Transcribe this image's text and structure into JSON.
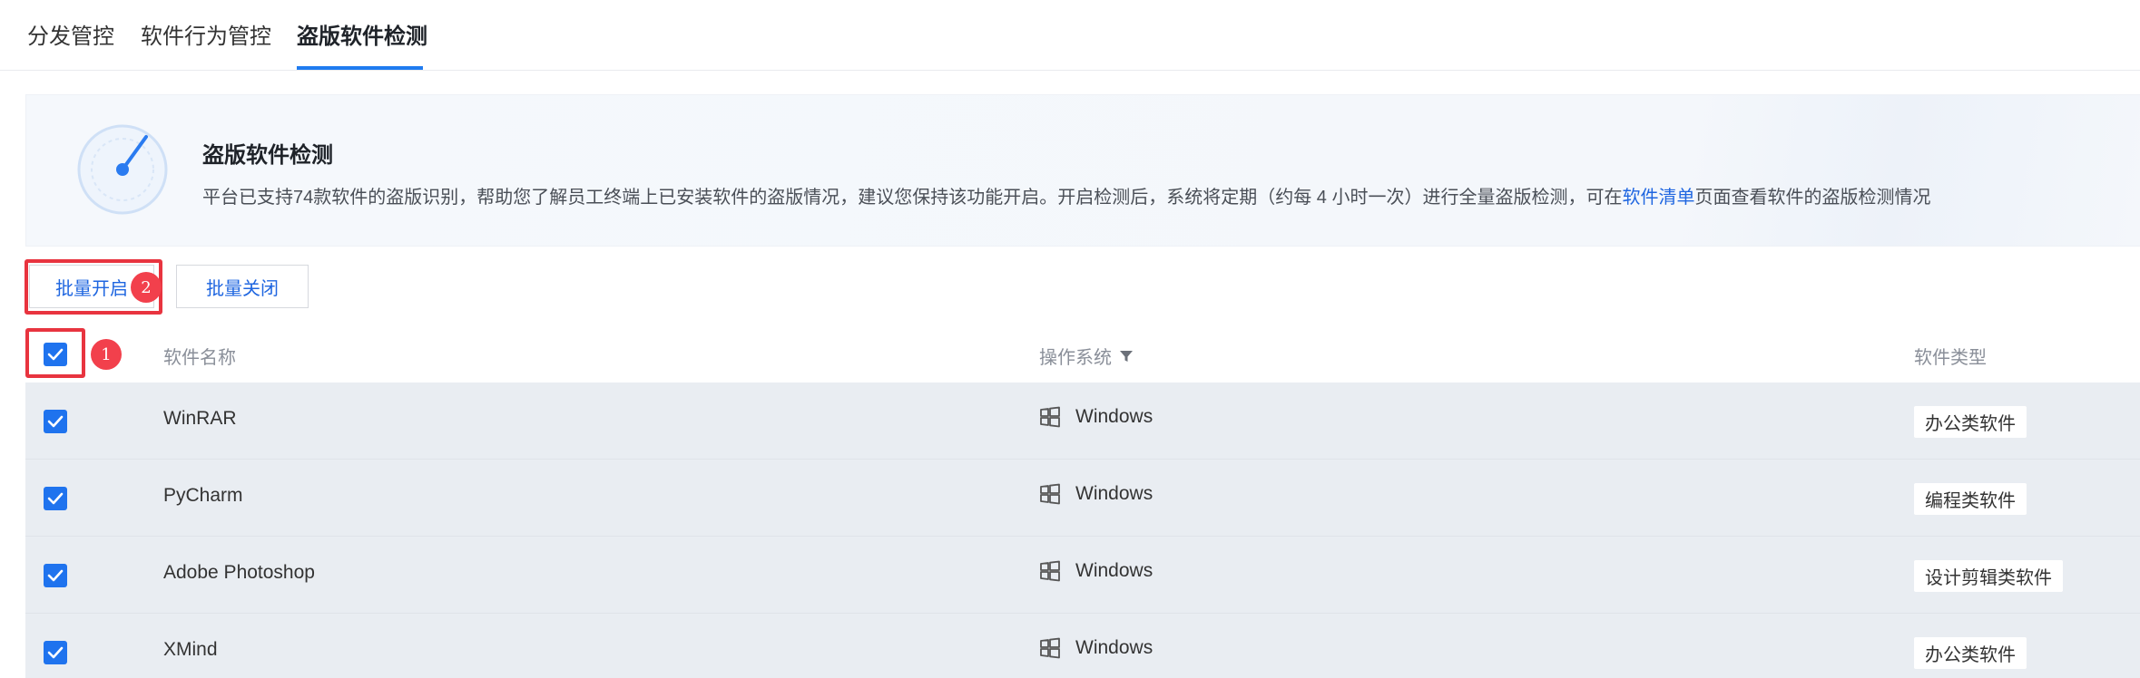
{
  "tabs": [
    {
      "label": "分发管控",
      "active": false
    },
    {
      "label": "软件行为管控",
      "active": false
    },
    {
      "label": "盗版软件检测",
      "active": true
    }
  ],
  "banner": {
    "icon": "gauge-icon",
    "title": "盗版软件检测",
    "desc_before": "平台已支持74款软件的盗版识别，帮助您了解员工终端上已安装软件的盗版情况，建议您保持该功能开启。开启检测后，系统将定期（约每 4 小时一次）进行全量盗版检测，可在",
    "desc_link": "软件清单",
    "desc_after": "页面查看软件的盗版检测情况"
  },
  "actions": {
    "batch_on": "批量开启",
    "batch_off": "批量关闭"
  },
  "annotations": {
    "step1": "1",
    "step2": "2",
    "color": "#e8343f"
  },
  "table": {
    "headers": {
      "name": "软件名称",
      "os": "操作系统",
      "type": "软件类型"
    },
    "select_all_checked": true,
    "rows": [
      {
        "checked": true,
        "name": "WinRAR",
        "os": "Windows",
        "type": "办公类软件"
      },
      {
        "checked": true,
        "name": "PyCharm",
        "os": "Windows",
        "type": "编程类软件"
      },
      {
        "checked": true,
        "name": "Adobe Photoshop",
        "os": "Windows",
        "type": "设计剪辑类软件"
      },
      {
        "checked": true,
        "name": "XMind",
        "os": "Windows",
        "type": "办公类软件"
      }
    ]
  },
  "colors": {
    "accent": "#1f73ee",
    "link": "#1f66e0",
    "row_bg": "#e9edf2"
  }
}
